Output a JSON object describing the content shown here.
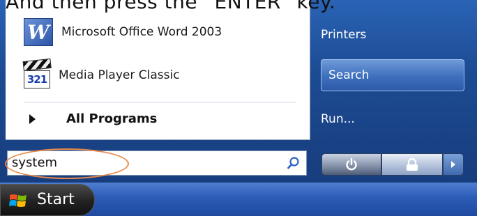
{
  "instruction": "And then press the “ENTER” key.",
  "programs": [
    {
      "label": "Microsoft Office Word 2003",
      "icon": "word-icon"
    },
    {
      "label": "Media Player Classic",
      "icon": "media-player-icon",
      "icon_text": "321"
    }
  ],
  "all_programs": "All Programs",
  "search": {
    "value": "system",
    "icon": "search-icon"
  },
  "right_panel": {
    "printers": "Printers",
    "search": "Search",
    "run": "Run..."
  },
  "buttons": {
    "power": "power-icon",
    "lock": "lock-icon",
    "more": "arrow-right-icon"
  },
  "taskbar": {
    "start_label": "Start"
  },
  "colors": {
    "highlight_oval": "#e8894a",
    "menu_blue": "#1d4b93",
    "taskbar_blue": "#2b5cb6"
  }
}
